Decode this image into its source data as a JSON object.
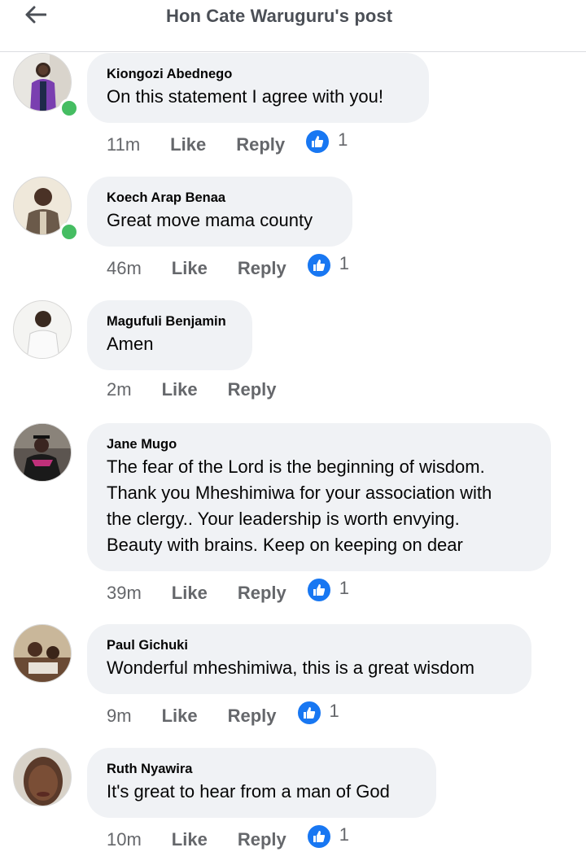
{
  "header": {
    "title": "Hon Cate Waruguru's post",
    "back_icon": "back-arrow-icon"
  },
  "comments": [
    {
      "author": "Kiongozi Abednego",
      "text": "On this statement I agree with you!",
      "time": "11m",
      "like_label": "Like",
      "reply_label": "Reply",
      "reactions": "1",
      "online": true
    },
    {
      "author": "Koech Arap Benaa",
      "text": "Great move mama county",
      "time": "46m",
      "like_label": "Like",
      "reply_label": "Reply",
      "reactions": "1",
      "online": true
    },
    {
      "author": "Magufuli Benjamin",
      "text": "Amen",
      "time": "2m",
      "like_label": "Like",
      "reply_label": "Reply",
      "reactions": null,
      "online": false
    },
    {
      "author": "Jane Mugo",
      "text": "The fear of the Lord is the beginning of wisdom.\nThank you Mheshimiwa for your association with\nthe clergy.. Your leadership is worth envying.\nBeauty with brains. Keep on keeping on dear",
      "time": "39m",
      "like_label": "Like",
      "reply_label": "Reply",
      "reactions": "1",
      "online": false
    },
    {
      "author": "Paul Gichuki",
      "text": "Wonderful mheshimiwa, this is a great wisdom",
      "time": "9m",
      "like_label": "Like",
      "reply_label": "Reply",
      "reactions": "1",
      "online": false
    },
    {
      "author": "Ruth Nyawira",
      "text": "It's great to hear from a man of God",
      "time": "10m",
      "like_label": "Like",
      "reply_label": "Reply",
      "reactions": "1",
      "online": false
    }
  ],
  "colors": {
    "like_blue": "#1877f2",
    "online_green": "#45bd62",
    "bubble_bg": "#f0f2f5",
    "meta_gray": "#65676b"
  }
}
